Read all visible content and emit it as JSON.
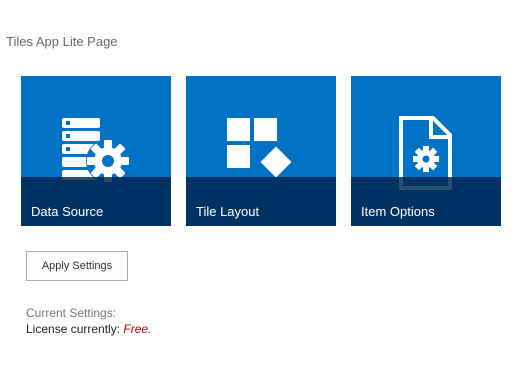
{
  "page": {
    "title": "Tiles App Lite Page"
  },
  "tiles": [
    {
      "label": "Data Source",
      "icon": "database-gear-icon"
    },
    {
      "label": "Tile Layout",
      "icon": "tile-layout-icon"
    },
    {
      "label": "Item Options",
      "icon": "document-gear-icon"
    }
  ],
  "actions": {
    "apply_label": "Apply Settings"
  },
  "settings": {
    "heading": "Current Settings:",
    "license_label": "License currently:",
    "license_value": "Free."
  },
  "colors": {
    "tile_background": "#0072c6",
    "tile_band": "#00264e",
    "license_value": "#c00000"
  }
}
